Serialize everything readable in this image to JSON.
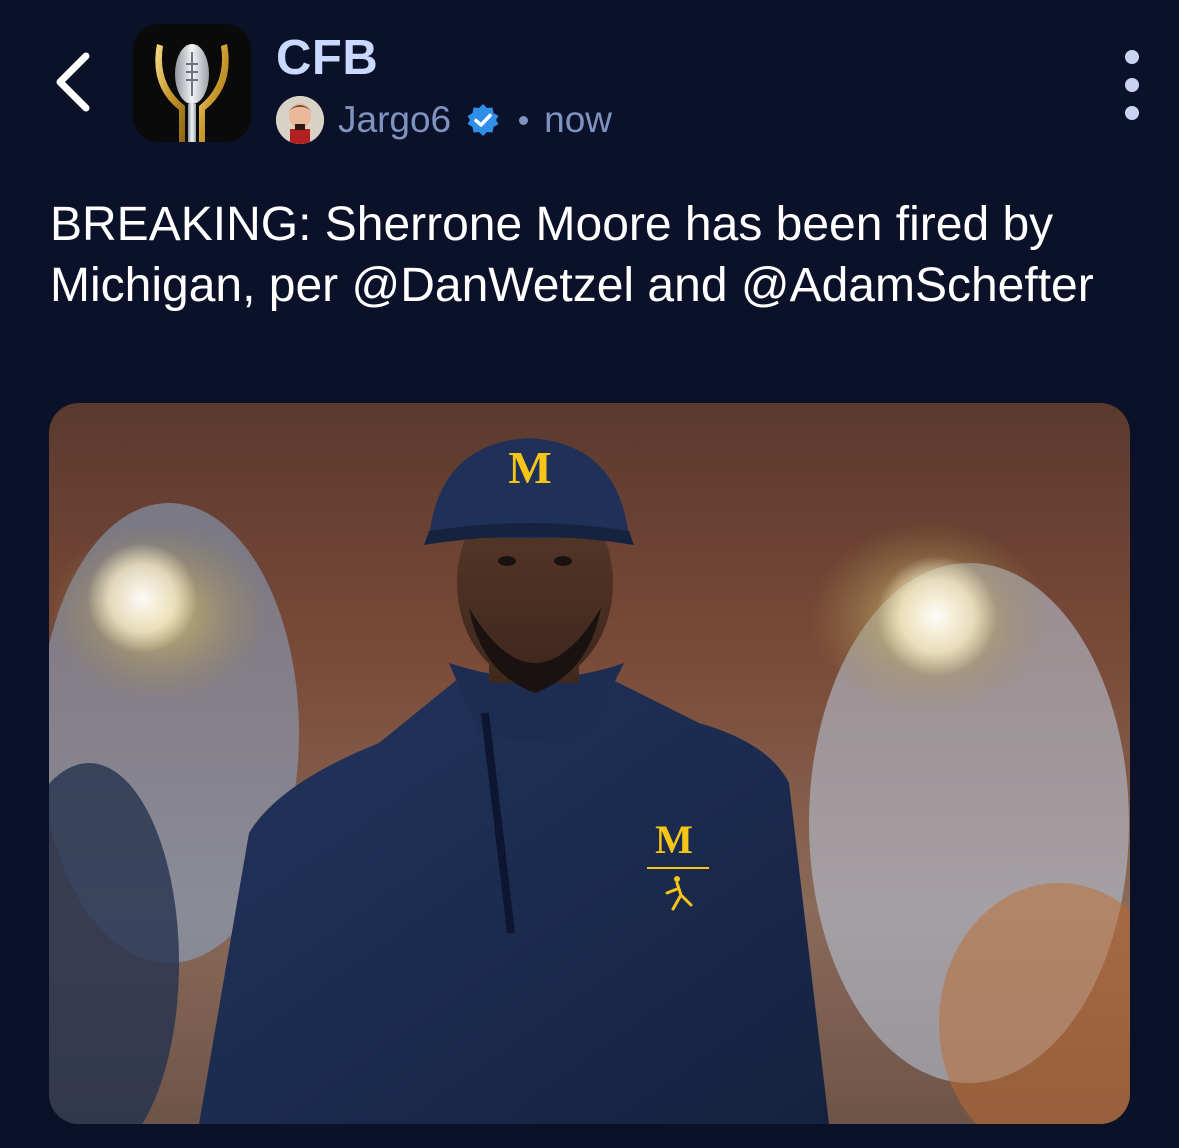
{
  "header": {
    "back_icon": "chevron-left-icon",
    "community_name": "CFB",
    "community_icon": "trophy-icon",
    "author": "Jargo6",
    "author_verified": true,
    "verified_icon": "verified-badge-icon",
    "separator": "•",
    "timestamp": "now",
    "more_icon": "vertical-dots-icon"
  },
  "post": {
    "text": "BREAKING: Sherrone Moore has been fired by Michigan, per @DanWetzel and @AdamSchefter"
  },
  "colors": {
    "background": "#0b1129",
    "accent_title": "#c9d9ff",
    "meta_text": "#7f93bf",
    "verified_blue": "#2f8fe8",
    "michigan_maize": "#f5c518",
    "michigan_navy": "#1b2a4e"
  }
}
